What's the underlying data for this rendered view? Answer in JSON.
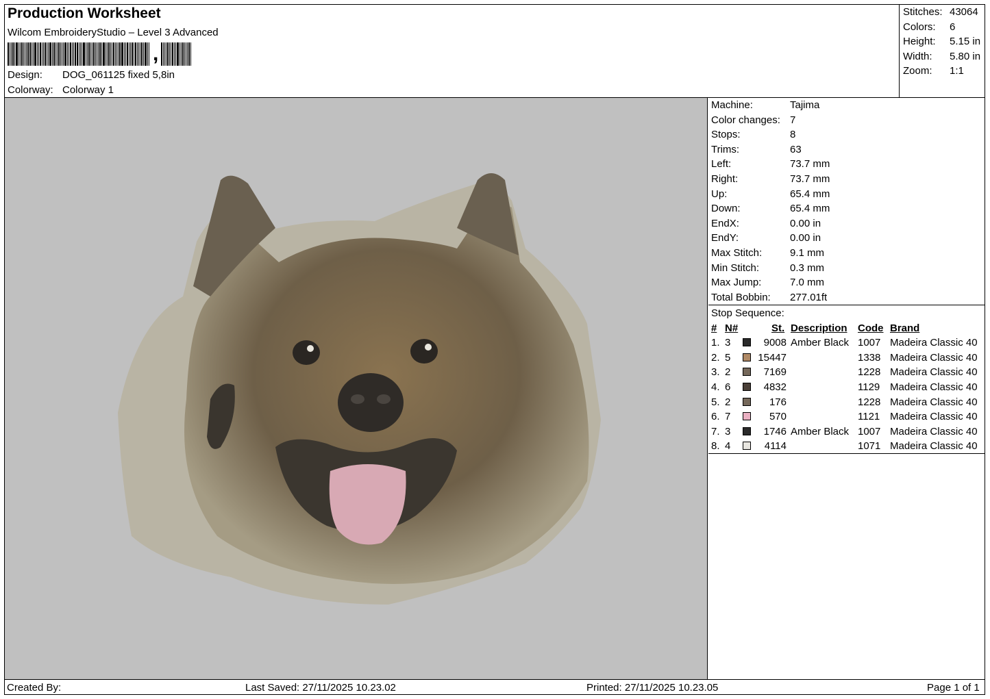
{
  "header": {
    "title": "Production Worksheet",
    "software": "Wilcom EmbroideryStudio – Level 3 Advanced",
    "design_label": "Design:",
    "design_value": "DOG_061125 fixed 5,8in",
    "colorway_label": "Colorway:",
    "colorway_value": "Colorway 1"
  },
  "stats": [
    {
      "label": "Stitches:",
      "value": "43064"
    },
    {
      "label": "Colors:",
      "value": "6"
    },
    {
      "label": "Height:",
      "value": "5.15 in"
    },
    {
      "label": "Width:",
      "value": "5.80 in"
    },
    {
      "label": "Zoom:",
      "value": "1:1"
    }
  ],
  "machine": [
    {
      "label": "Machine:",
      "value": "Tajima"
    },
    {
      "label": "Color changes:",
      "value": "7"
    },
    {
      "label": "Stops:",
      "value": "8"
    },
    {
      "label": "Trims:",
      "value": "63"
    },
    {
      "label": "Left:",
      "value": "73.7 mm"
    },
    {
      "label": "Right:",
      "value": "73.7 mm"
    },
    {
      "label": "Up:",
      "value": "65.4 mm"
    },
    {
      "label": "Down:",
      "value": "65.4 mm"
    },
    {
      "label": "EndX:",
      "value": "0.00 in"
    },
    {
      "label": "EndY:",
      "value": "0.00 in"
    },
    {
      "label": "Max Stitch:",
      "value": "9.1 mm"
    },
    {
      "label": "Min Stitch:",
      "value": "0.3 mm"
    },
    {
      "label": "Max Jump:",
      "value": "7.0 mm"
    },
    {
      "label": "Total Bobbin:",
      "value": "277.01ft"
    }
  ],
  "stop_sequence": {
    "title": "Stop Sequence:",
    "headers": {
      "num": "#",
      "n": "N#",
      "st": "St.",
      "desc": "Description",
      "code": "Code",
      "brand": "Brand"
    },
    "rows": [
      {
        "num": "1.",
        "n": "3",
        "st": "9008",
        "color": "#2a2a2a",
        "desc": "Amber Black",
        "code": "1007",
        "brand": "Madeira Classic 40"
      },
      {
        "num": "2.",
        "n": "5",
        "st": "15447",
        "color": "#b08a66",
        "desc": "",
        "code": "1338",
        "brand": "Madeira Classic 40"
      },
      {
        "num": "3.",
        "n": "2",
        "st": "7169",
        "color": "#75685a",
        "desc": "",
        "code": "1228",
        "brand": "Madeira Classic 40"
      },
      {
        "num": "4.",
        "n": "6",
        "st": "4832",
        "color": "#4a3f38",
        "desc": "",
        "code": "1129",
        "brand": "Madeira Classic 40"
      },
      {
        "num": "5.",
        "n": "2",
        "st": "176",
        "color": "#75685a",
        "desc": "",
        "code": "1228",
        "brand": "Madeira Classic 40"
      },
      {
        "num": "6.",
        "n": "7",
        "st": "570",
        "color": "#eab0c2",
        "desc": "",
        "code": "1121",
        "brand": "Madeira Classic 40"
      },
      {
        "num": "7.",
        "n": "3",
        "st": "1746",
        "color": "#2a2a2a",
        "desc": "Amber Black",
        "code": "1007",
        "brand": "Madeira Classic 40"
      },
      {
        "num": "8.",
        "n": "4",
        "st": "4114",
        "color": "#e8e6e0",
        "desc": "",
        "code": "1071",
        "brand": "Madeira Classic 40"
      }
    ]
  },
  "footer": {
    "created_by": "Created By:",
    "last_saved": "Last Saved: 27/11/2025 10.23.02",
    "printed": "Printed: 27/11/2025 10.23.05",
    "page": "Page 1 of 1"
  },
  "design_preview": {
    "background": "#c0c0c0",
    "subject": "embroidered dog-head-icon"
  }
}
